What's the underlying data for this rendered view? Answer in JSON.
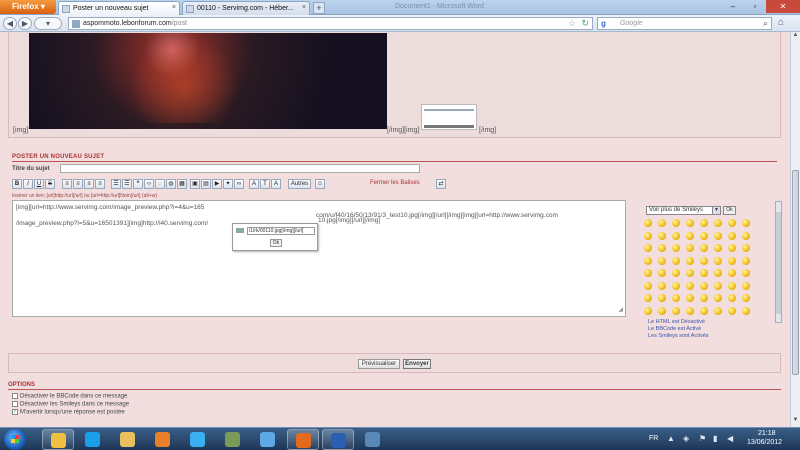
{
  "browser": {
    "menu_button": "Firefox",
    "tabs": [
      {
        "label": "Poster un nouveau sujet"
      },
      {
        "label": "00110 - Servimg.com - Héber..."
      }
    ],
    "window_title": "Document1 - Microsoft Word",
    "url_host": "aspommoto.lebonforum.com",
    "url_path": "/post",
    "search_engine": "Google",
    "search_letter": "g"
  },
  "preview": {
    "img_tag_left": "[img]",
    "img_tag_mid": "[/img][img]",
    "img_tag_right": "[/img]"
  },
  "editor": {
    "section_title": "POSTER UN NOUVEAU SUJET",
    "subject_label": "Titre du sujet",
    "toolbar": {
      "bold": "B",
      "italic": "I",
      "underline": "U",
      "strike": "S",
      "authors": "Autres",
      "close_tags": "Fermer les Balises"
    },
    "help_text": "Insérer un lien: [url]http://url[/url] ou [url=http://url]Nom[/url] (alt+w)",
    "message": "[img][url=http://www.servimg.com/image_preview.php?i=4&u=16501391]...",
    "message_lines": [
      "[img][url=http://www.servimg.com/image_preview.php?i=4&u=165",
      "com/u/f40/16/50/13/91/3_test10.jpg[/img][/url][/img][img][url=http://www.servimg.com",
      "/image_preview.php?i=5&u=16501391][img]http://i40.servimg.com/",
      "10.jpg[/img][/url][/img]"
    ],
    "popup_value": "i1/rk/00110.jpg[/img][/url]",
    "popup_ok": "Ok"
  },
  "smileys": {
    "select_label": "Voir plus de Smileys",
    "ok_label": "Ok",
    "html_status": "Le HTML est Désactivé",
    "bbcode_status": "Le BBCode est Activé",
    "smileys_status": "Les Smileys sont Activés",
    "badge_text": "LOL"
  },
  "buttons": {
    "preview": "Prévisualiser",
    "send": "Envoyer"
  },
  "options": {
    "title": "OPTIONS",
    "items": [
      {
        "label": "Désactiver le BBCode dans ce message",
        "checked": false
      },
      {
        "label": "Désactiver les Smileys dans ce message",
        "checked": false
      },
      {
        "label": "M'avertir lorsqu'une réponse est postée",
        "checked": true
      }
    ]
  },
  "taskbar": {
    "language": "FR",
    "time": "21:18",
    "date": "13/06/2012",
    "apps": [
      {
        "name": "mail-app-icon",
        "color": "#f0c040"
      },
      {
        "name": "skype-icon",
        "color": "#1aa0e6"
      },
      {
        "name": "explorer-icon",
        "color": "#e8c060"
      },
      {
        "name": "media-player-icon",
        "color": "#e8802a"
      },
      {
        "name": "internet-explorer-icon",
        "color": "#3ab0f0"
      },
      {
        "name": "tool-icon",
        "color": "#7a9a5a"
      },
      {
        "name": "dropbox-icon",
        "color": "#5fa8e8"
      },
      {
        "name": "firefox-icon",
        "color": "#e66a1e"
      },
      {
        "name": "word-icon",
        "color": "#2b5fb4"
      },
      {
        "name": "picture-viewer-icon",
        "color": "#5a88b8"
      }
    ]
  },
  "colors": {
    "page_background": "#f2dede",
    "section_title": "#aa3333",
    "link_status": "#3355aa"
  }
}
